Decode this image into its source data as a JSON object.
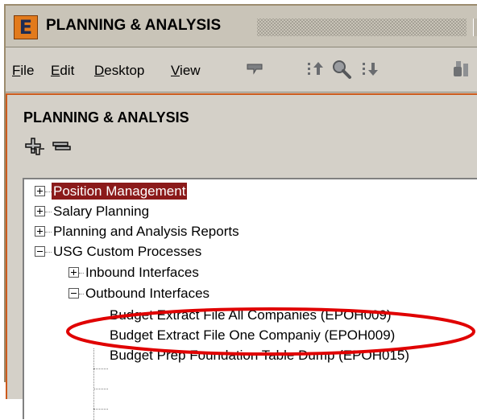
{
  "window": {
    "logo_letter": "E",
    "title": "PLANNING & ANALYSIS"
  },
  "menubar": {
    "items": [
      {
        "mnemonic": "F",
        "rest": "ile"
      },
      {
        "mnemonic": "E",
        "rest": "dit"
      },
      {
        "mnemonic": "D",
        "rest": "esktop"
      },
      {
        "mnemonic": "V",
        "rest": "iew"
      }
    ],
    "toolbar_icons": [
      "comment-icon",
      "move-up-icon",
      "search-icon",
      "move-down-icon",
      "binoculars-icon"
    ]
  },
  "panel": {
    "title": "PLANNING & ANALYSIS",
    "tools": [
      "expand-all-icon",
      "collapse-all-icon"
    ]
  },
  "tree": {
    "items": [
      {
        "label": "Position Management",
        "state": "collapsed",
        "selected": true
      },
      {
        "label": "Salary Planning",
        "state": "collapsed",
        "selected": false
      },
      {
        "label": "Planning and Analysis Reports",
        "state": "collapsed",
        "selected": false
      },
      {
        "label": "USG Custom Processes",
        "state": "expanded",
        "selected": false
      },
      {
        "label": "Inbound Interfaces",
        "state": "collapsed",
        "selected": false
      },
      {
        "label": "Outbound Interfaces",
        "state": "expanded",
        "selected": false
      },
      {
        "label": "Budget Extract File All Companies (EPOH009)",
        "state": "leaf",
        "selected": false
      },
      {
        "label": "Budget Extract File One Companiy (EPOH009)",
        "state": "leaf",
        "selected": false
      },
      {
        "label": "Budget Prep Foundation Table Dump (EPOH015)",
        "state": "leaf",
        "selected": false
      }
    ]
  },
  "annotation": {
    "color": "#e00000",
    "shape": "ellipse"
  },
  "colors": {
    "selection": "#8b1a1a",
    "panel_border": "#cc5a1c",
    "logo": "#e27a1c"
  }
}
